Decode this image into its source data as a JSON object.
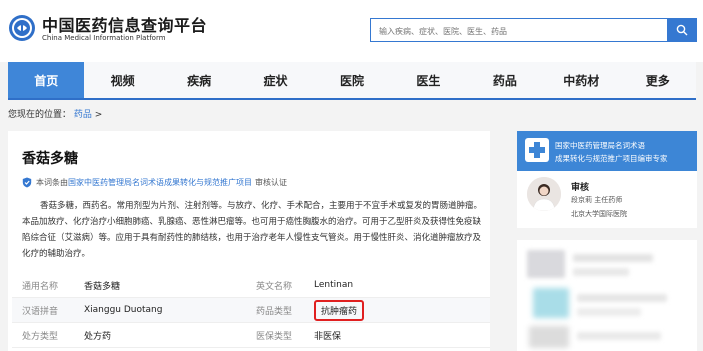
{
  "header": {
    "site_name": "中国医药信息查询平台",
    "site_name_en": "China Medical Information Platform",
    "search_placeholder": "输入疾病、症状、医院、医生、药品",
    "brand_color": "#3578d1"
  },
  "nav": {
    "items": [
      "首页",
      "视频",
      "疾病",
      "症状",
      "医院",
      "医生",
      "药品",
      "中药材",
      "更多"
    ],
    "active_index": 0
  },
  "breadcrumb": {
    "prefix": "您现在的位置：",
    "link": "药品",
    "separator": ">"
  },
  "article": {
    "title": "香菇多糖",
    "verify_prefix": "本词条由",
    "verify_org": "国家中医药管理局名词术语成果转化与规范推广项目",
    "verify_suffix": "审核认证",
    "intro": "香菇多糖，西药名。常用剂型为片剂、注射剂等。与放疗、化疗、手术配合，主要用于不宜手术或复发的胃肠道肿瘤。本品加放疗、化疗治疗小细胞肺癌、乳腺癌、恶性淋巴瘤等。也可用于癌性胸腹水的治疗。可用于乙型肝炎及获得性免疫缺陷综合征（艾滋病）等。应用于具有耐药性的肺结核，也用于治疗老年人慢性支气管炎。用于慢性肝炎、消化道肿瘤放疗及化疗的辅助治疗。",
    "info": [
      {
        "label": "通用名称",
        "value": "香菇多糖",
        "label2": "英文名称",
        "value2": "Lentinan"
      },
      {
        "label": "汉语拼音",
        "value": "Xianggu Duotang",
        "label2": "药品类型",
        "value2": "抗肿瘤药"
      },
      {
        "label": "处方类型",
        "value": "处方药",
        "label2": "医保类型",
        "value2": "非医保"
      }
    ]
  },
  "sidebar": {
    "banner_line1": "国家中医药管理局名词术语",
    "banner_line2": "成果转化与规范推广项目编审专家",
    "reviewer_title": "审核",
    "reviewer_name": "段京莉 主任药师",
    "reviewer_org": "北京大学国际医院"
  }
}
